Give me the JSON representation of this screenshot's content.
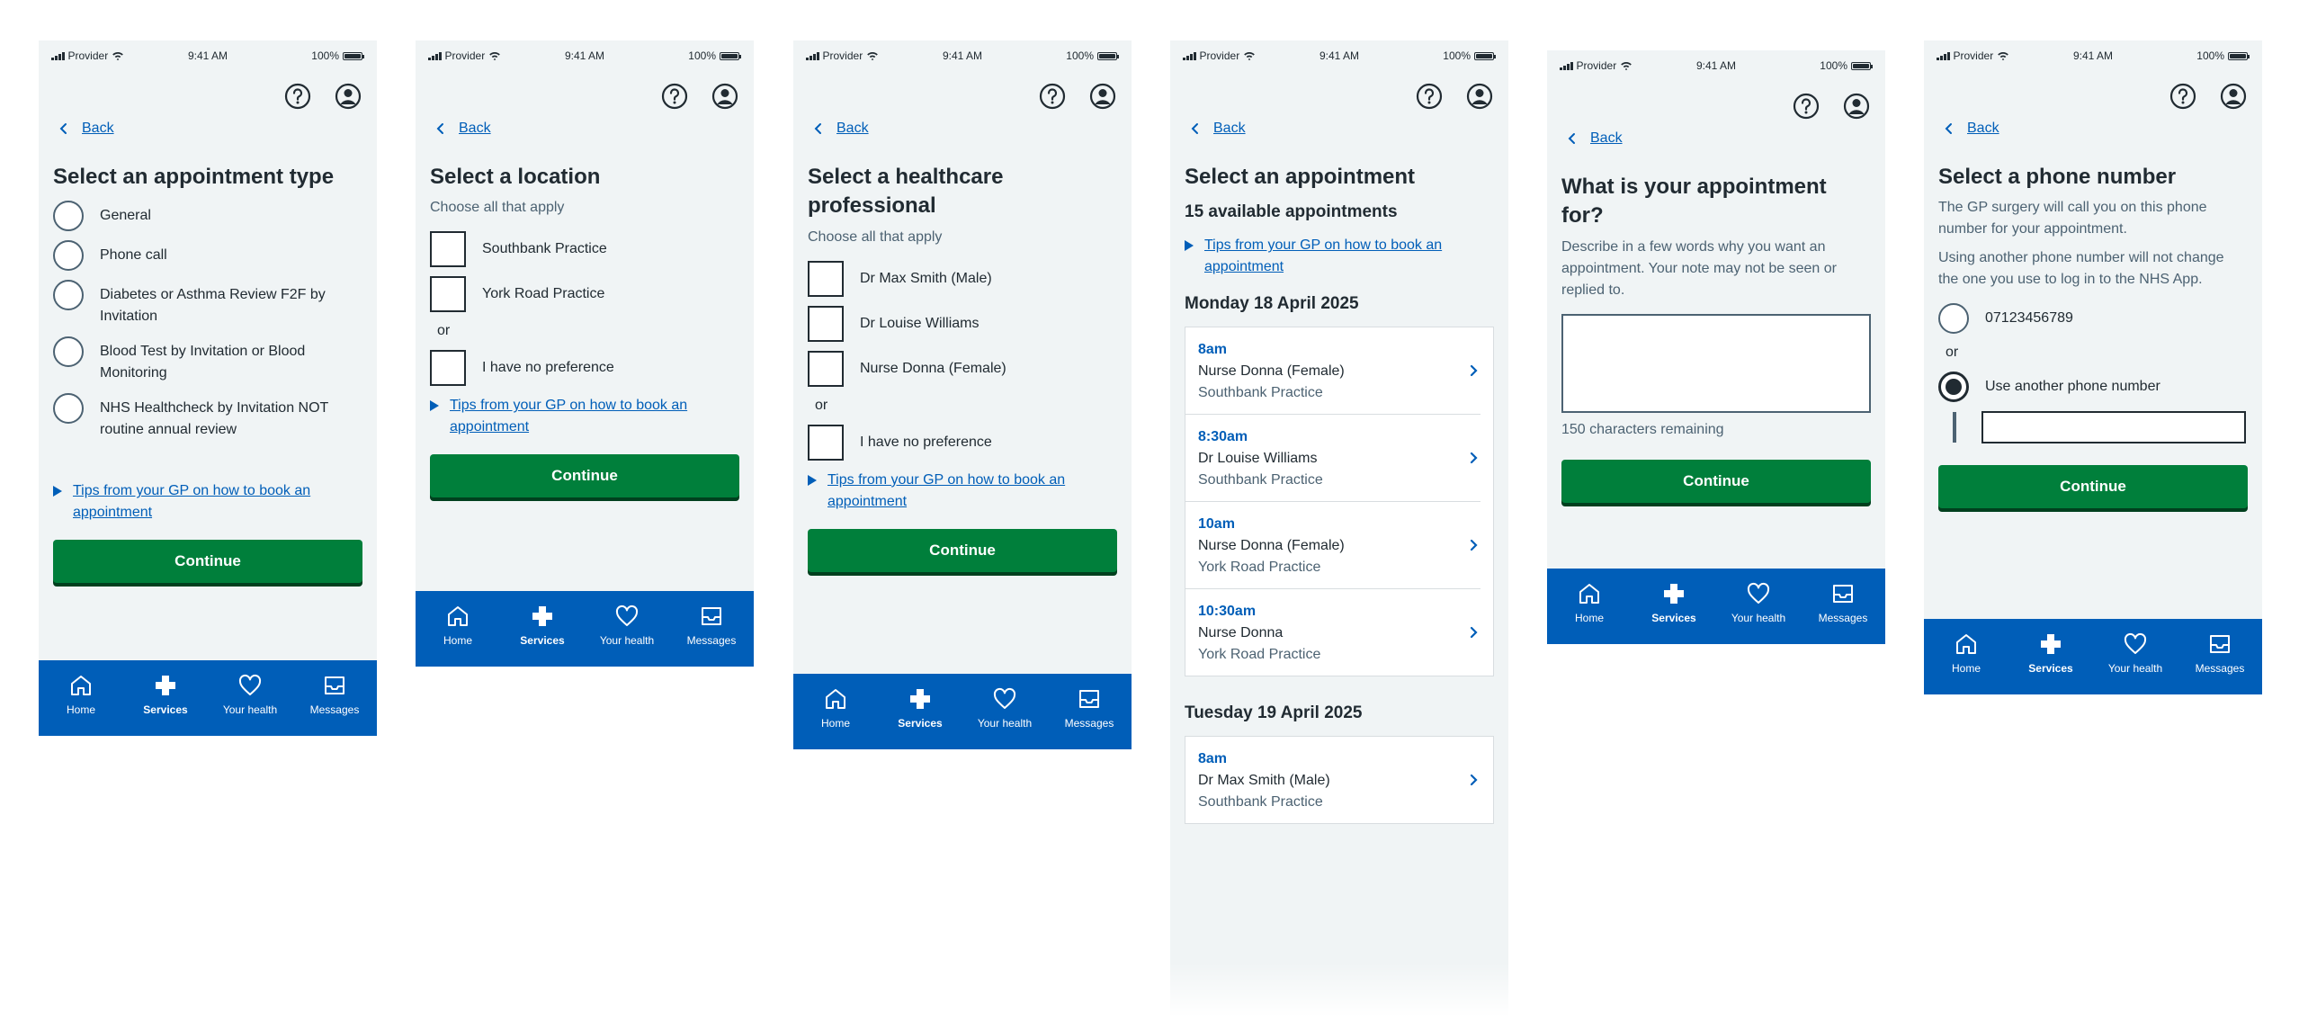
{
  "status": {
    "provider": "Provider",
    "time": "9:41 AM",
    "battery": "100%"
  },
  "nav": {
    "home": "Home",
    "services": "Services",
    "health": "Your health",
    "messages": "Messages"
  },
  "back": "Back",
  "continue": "Continue",
  "or": "or",
  "tips": "Tips from your GP on how to book an appointment",
  "screen1": {
    "title": "Select an appointment type",
    "options": [
      "General",
      "Phone call",
      "Diabetes or Asthma Review F2F by Invitation",
      "Blood Test by Invitation or Blood Monitoring",
      "NHS Healthcheck by Invitation NOT routine annual review"
    ]
  },
  "screen2": {
    "title": "Select a location",
    "hint": "Choose all that apply",
    "options": [
      "Southbank Practice",
      "York Road Practice"
    ],
    "no_pref": "I have no preference"
  },
  "screen3": {
    "title": "Select a healthcare professional",
    "hint": "Choose all that apply",
    "options": [
      "Dr Max Smith (Male)",
      "Dr Louise Williams",
      "Nurse Donna (Female)"
    ],
    "no_pref": "I have no preference"
  },
  "screen4": {
    "title": "Select an appointment",
    "count": "15 available appointments",
    "days": [
      {
        "date": "Monday 18 April 2025",
        "slots": [
          {
            "time": "8am",
            "person": "Nurse Donna (Female)",
            "place": "Southbank Practice"
          },
          {
            "time": "8:30am",
            "person": "Dr Louise Williams",
            "place": "Southbank Practice"
          },
          {
            "time": "10am",
            "person": "Nurse Donna (Female)",
            "place": "York Road Practice"
          },
          {
            "time": "10:30am",
            "person": "Nurse Donna",
            "place": "York Road Practice"
          }
        ]
      },
      {
        "date": "Tuesday 19 April 2025",
        "slots": [
          {
            "time": "8am",
            "person": "Dr Max Smith (Male)",
            "place": "Southbank Practice"
          }
        ]
      }
    ]
  },
  "screen5": {
    "title": "What is your appointment for?",
    "hint": "Describe in a few words why you want an appointment. Your note may not be seen or replied to.",
    "remaining": "150 characters remaining"
  },
  "screen6": {
    "title": "Select a phone number",
    "hint1": "The GP surgery will call you on this phone number for your appointment.",
    "hint2": "Using another phone number will not change the one you use to log in to the NHS App.",
    "phone": "07123456789",
    "other": "Use another phone number"
  },
  "colors": {
    "nhs_blue": "#005eb8",
    "green": "#007f3b",
    "background": "#f0f4f5",
    "text": "#212b32"
  }
}
